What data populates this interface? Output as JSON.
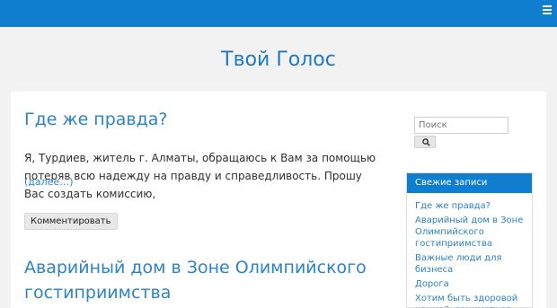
{
  "header": {
    "menu_icon": "hamburger-menu-icon"
  },
  "site": {
    "title": "Твой Голос"
  },
  "posts": [
    {
      "title": "Где же правда?",
      "excerpt": "Я, Турдиев, житель г. Алматы, обращаюсь к Вам за помощью потеряв всю надежду на правду и справедливость. Прошу Вас создать комиссию,",
      "read_more": "(далее…)",
      "comment_button": "Комментировать"
    },
    {
      "title": "Аварийный дом в Зоне Олимпийского гостиприимства"
    }
  ],
  "sidebar": {
    "search": {
      "placeholder": "Поиск",
      "icon": "search-icon"
    },
    "recent_posts": {
      "title": "Свежие записи",
      "items": [
        "Где же правда?",
        "Аварийный дом в Зоне Олимпийского гостиприимства",
        "Важные люди для бизнеса",
        "Дорога",
        "Хотим быть здоровой нацией, заниматься"
      ]
    }
  },
  "colors": {
    "brand": "#0f7ecf",
    "link": "#2d83c7",
    "background": "#f2f2f2"
  }
}
